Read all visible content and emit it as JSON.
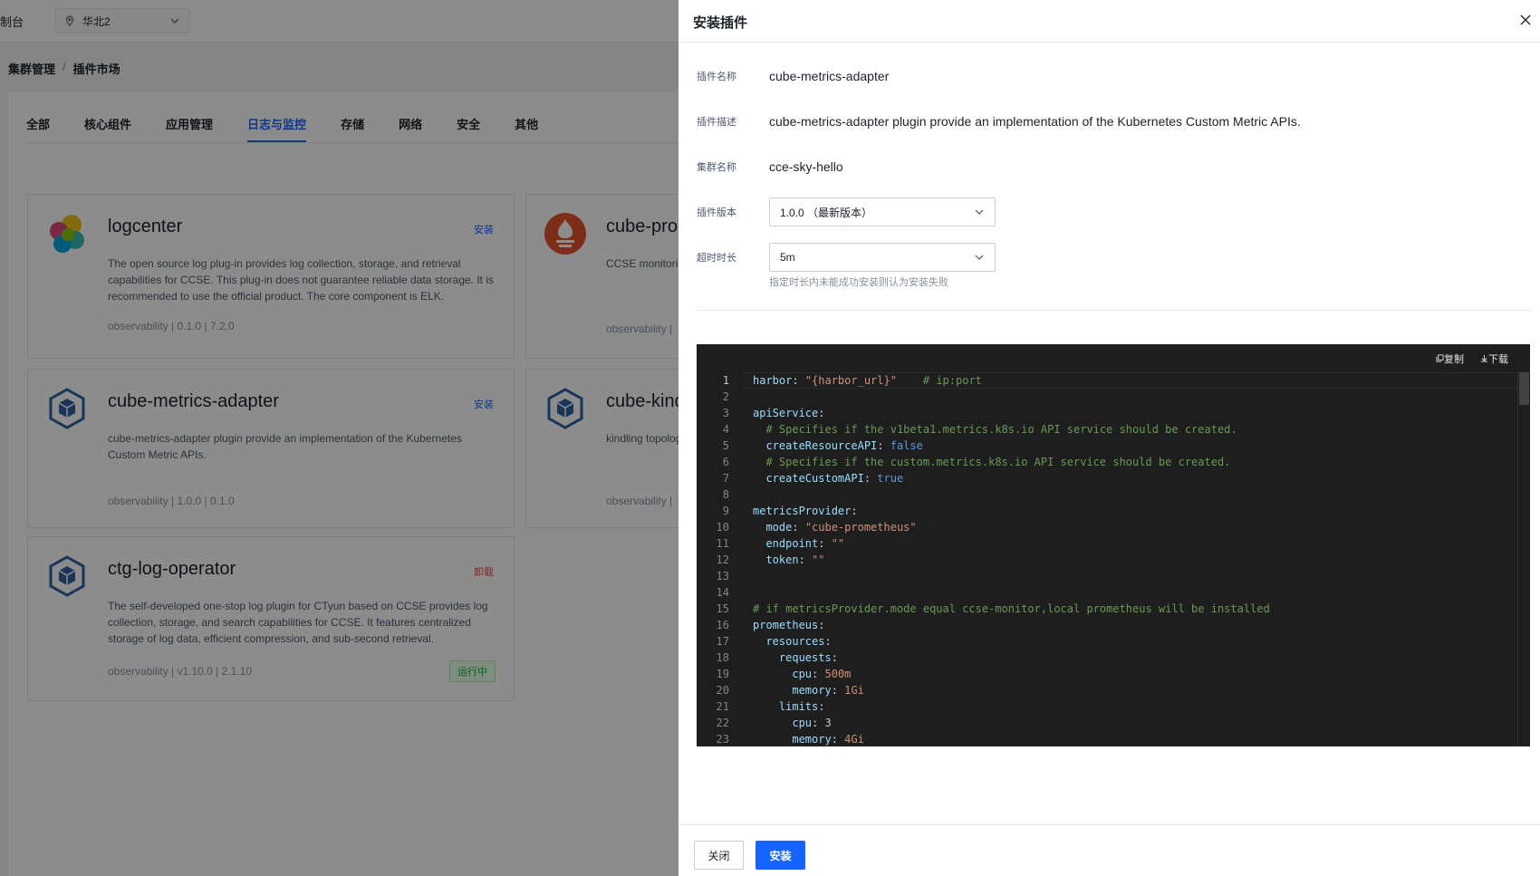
{
  "topbar": {
    "brand_fragment": "制台",
    "region": "华北2"
  },
  "breadcrumb": {
    "parent": "集群管理",
    "separator": "/",
    "current": "插件市场"
  },
  "tabs": [
    "全部",
    "核心组件",
    "应用管理",
    "日志与监控",
    "存储",
    "网络",
    "安全",
    "其他"
  ],
  "active_tab": "日志与监控",
  "cards": [
    {
      "title": "logcenter",
      "action": "安装",
      "desc": "The open source log plug-in provides log collection, storage, and retrieval capabilities for CCSE. This plug-in does not guarantee reliable data storage. It is recommended to use the official product. The core component is ELK.",
      "meta": "observability | 0.1.0 | 7.2.0"
    },
    {
      "title": "cube-prometheus",
      "desc": "CCSE monitoring",
      "meta": "observability | "
    },
    {
      "title": "cube-metrics-adapter",
      "action": "安装",
      "desc": "cube-metrics-adapter plugin provide an implementation of the Kubernetes Custom Metric APIs.",
      "meta": "observability | 1.0.0 | 0.1.0"
    },
    {
      "title": "cube-kindling",
      "desc": "kindling topology",
      "meta": "observability | "
    },
    {
      "title": "ctg-log-operator",
      "action": "卸载",
      "desc": "The self-developed one-stop log plugin for CTyun based on CCSE provides log collection, storage, and search capabilities for CCSE. It features centralized storage of log data, efficient compression, and sub-second retrieval.",
      "meta": "observability | v1.10.0 | 2.1.10",
      "status": "运行中"
    }
  ],
  "drawer": {
    "title": "安装插件",
    "fields": {
      "name_label": "插件名称",
      "name_value": "cube-metrics-adapter",
      "desc_label": "插件描述",
      "desc_value": "cube-metrics-adapter plugin provide an implementation of the Kubernetes Custom Metric APIs.",
      "cluster_label": "集群名称",
      "cluster_value": "cce-sky-hello",
      "version_label": "插件版本",
      "version_value": "1.0.0 （最新版本）",
      "timeout_label": "超时时长",
      "timeout_value": "5m",
      "timeout_hint": "指定时长内未能成功安装则认为安装失败"
    },
    "code_tools": {
      "copy": "复制",
      "download": "下载"
    },
    "code_lines": [
      "harbor: \"{harbor_url}\"    # ip:port",
      "",
      "apiService:",
      "  # Specifies if the v1beta1.metrics.k8s.io API service should be created.",
      "  createResourceAPI: false",
      "  # Specifies if the custom.metrics.k8s.io API service should be created.",
      "  createCustomAPI: true",
      "",
      "metricsProvider:",
      "  mode: \"cube-prometheus\"",
      "  endpoint: \"\"",
      "  token: \"\"",
      "",
      "",
      "# if metricsProvider.mode equal ccse-monitor,local prometheus will be installed",
      "prometheus:",
      "  resources:",
      "    requests:",
      "      cpu: 500m",
      "      memory: 1Gi",
      "    limits:",
      "      cpu: 3",
      "      memory: 4Gi"
    ],
    "buttons": {
      "close": "关闭",
      "install": "安装"
    }
  },
  "colors": {
    "primary": "#1664ff",
    "danger": "#f53f3f",
    "success": "#00b42a",
    "code_bg": "#1e1e1e"
  }
}
